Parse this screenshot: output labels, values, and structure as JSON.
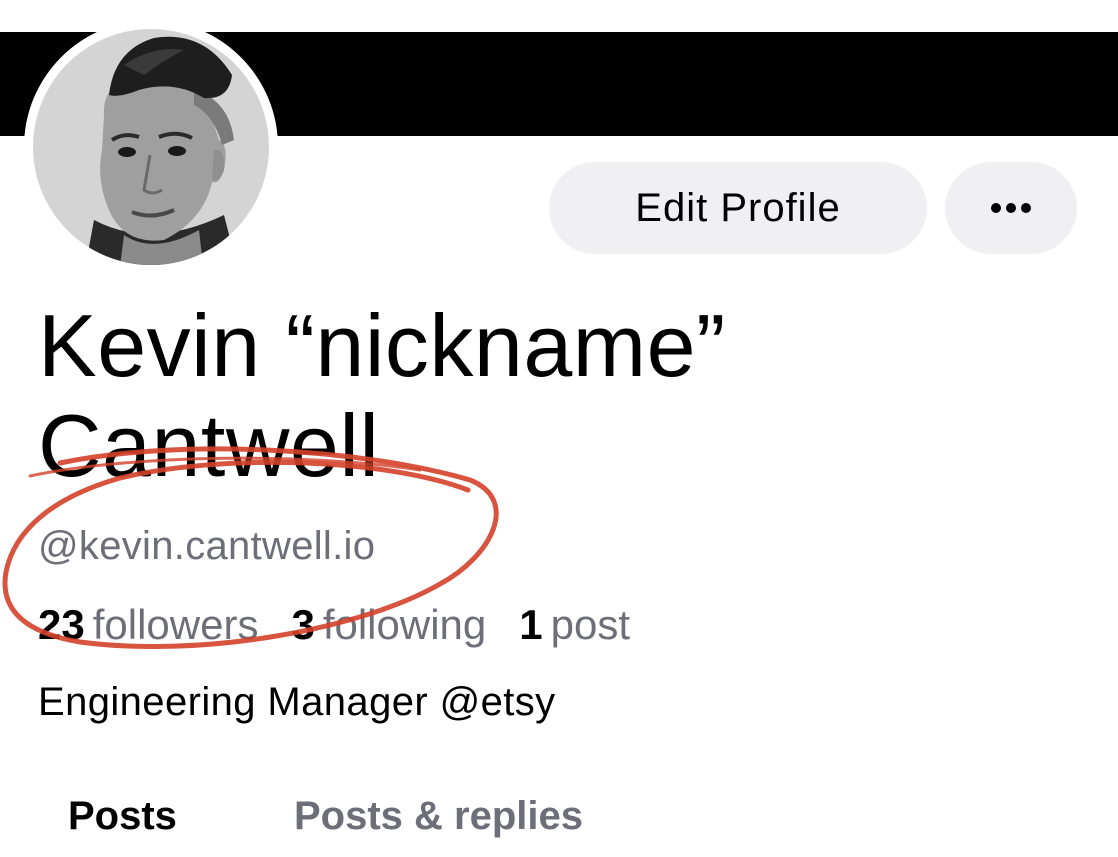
{
  "profile": {
    "display_name": "Kevin “nickname” Cantwell",
    "handle": "@kevin.cantwell.io",
    "bio": "Engineering Manager @etsy",
    "avatar_icon": "profile-photo"
  },
  "actions": {
    "edit_label": "Edit Profile",
    "more_icon": "ellipsis-icon"
  },
  "stats": [
    {
      "count": "23",
      "label": "followers"
    },
    {
      "count": "3",
      "label": "following"
    },
    {
      "count": "1",
      "label": "post"
    }
  ],
  "tabs": [
    {
      "label": "Posts",
      "active": true
    },
    {
      "label": "Posts & replies",
      "active": false
    }
  ],
  "colors": {
    "banner": "#000000",
    "button_bg": "#f0f0f3",
    "muted_text": "#6e6e78",
    "annotation": "#d4412a"
  }
}
